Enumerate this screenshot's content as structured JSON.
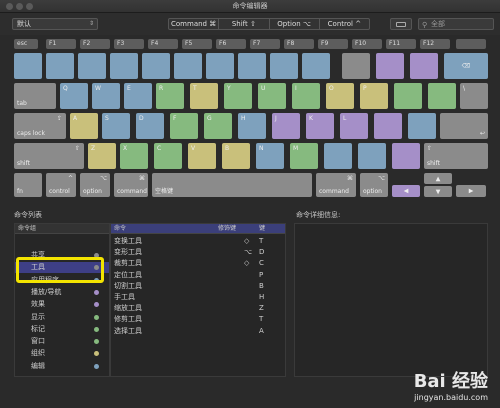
{
  "window": {
    "title": "命令编辑器"
  },
  "toolbar": {
    "preset": "默认",
    "modifiers": [
      "Command ⌘",
      "Shift ⇧",
      "Option ⌥",
      "Control ^"
    ],
    "search_placeholder": "全部"
  },
  "keyboard": {
    "fn_row": [
      "esc",
      "F1",
      "F2",
      "F3",
      "F4",
      "F5",
      "F6",
      "F7",
      "F8",
      "F9",
      "F10",
      "F11",
      "F12"
    ],
    "row1_end": "⌫",
    "tab": "tab",
    "row2_end": "\\",
    "caps": "caps lock",
    "caps_symbol": "⇪",
    "return": "↩",
    "shift_left": "shift",
    "shift_symbol": "⇧",
    "shift_right": "shift",
    "fn": "fn",
    "control_left": "control",
    "control_symbol": "^",
    "option_left": "option",
    "option_symbol": "⌥",
    "command_left": "command",
    "command_symbol": "⌘",
    "space": "空格键",
    "command_right": "command",
    "option_right": "option",
    "arrows": [
      "◀",
      "▲",
      "▼",
      "▶"
    ]
  },
  "colors": {
    "blue": "#7ea1bd",
    "green": "#86ba7f",
    "yellow": "#c9c07b",
    "purple": "#a58fc8",
    "gray": "#8b8b8b",
    "selection": "#3e3f86",
    "highlight": "#f3e400"
  },
  "panels": {
    "group_title": "命令列表",
    "group_header": "命令组",
    "groups": [
      {
        "label": "共享",
        "color": "#8b8b8b"
      },
      {
        "label": "工具",
        "color": "#8b8b8b",
        "selected": true
      },
      {
        "label": "应用程序",
        "color": "#7ea1bd"
      },
      {
        "label": "播放/导航",
        "color": "#a58fc8"
      },
      {
        "label": "效果",
        "color": "#a58fc8"
      },
      {
        "label": "显示",
        "color": "#86ba7f"
      },
      {
        "label": "标记",
        "color": "#86ba7f"
      },
      {
        "label": "窗口",
        "color": "#86ba7f"
      },
      {
        "label": "组织",
        "color": "#c9c07b"
      },
      {
        "label": "编辑",
        "color": "#7ea1bd"
      }
    ],
    "cmd_header": {
      "command": "命令",
      "modifier": "修饰键",
      "key": "键"
    },
    "commands": [
      {
        "command": "变换工具",
        "modifier": "",
        "key": "T"
      },
      {
        "command": "变形工具",
        "modifier": "⌥",
        "key": "D"
      },
      {
        "command": "裁剪工具",
        "modifier": "◇",
        "key": "C"
      },
      {
        "command": "定位工具",
        "modifier": "",
        "key": "P"
      },
      {
        "command": "切割工具",
        "modifier": "",
        "key": "B"
      },
      {
        "command": "手工具",
        "modifier": "",
        "key": "H"
      },
      {
        "command": "缩放工具",
        "modifier": "",
        "key": "Z"
      },
      {
        "command": "修剪工具",
        "modifier": "",
        "key": "T"
      },
      {
        "command": "选择工具",
        "modifier": "",
        "key": "A"
      }
    ],
    "extra_modifier_row0": "◇",
    "detail_title": "命令详细信息:"
  },
  "watermark": {
    "brand": "Bai 经验",
    "site": "jingyan.baidu.com"
  }
}
